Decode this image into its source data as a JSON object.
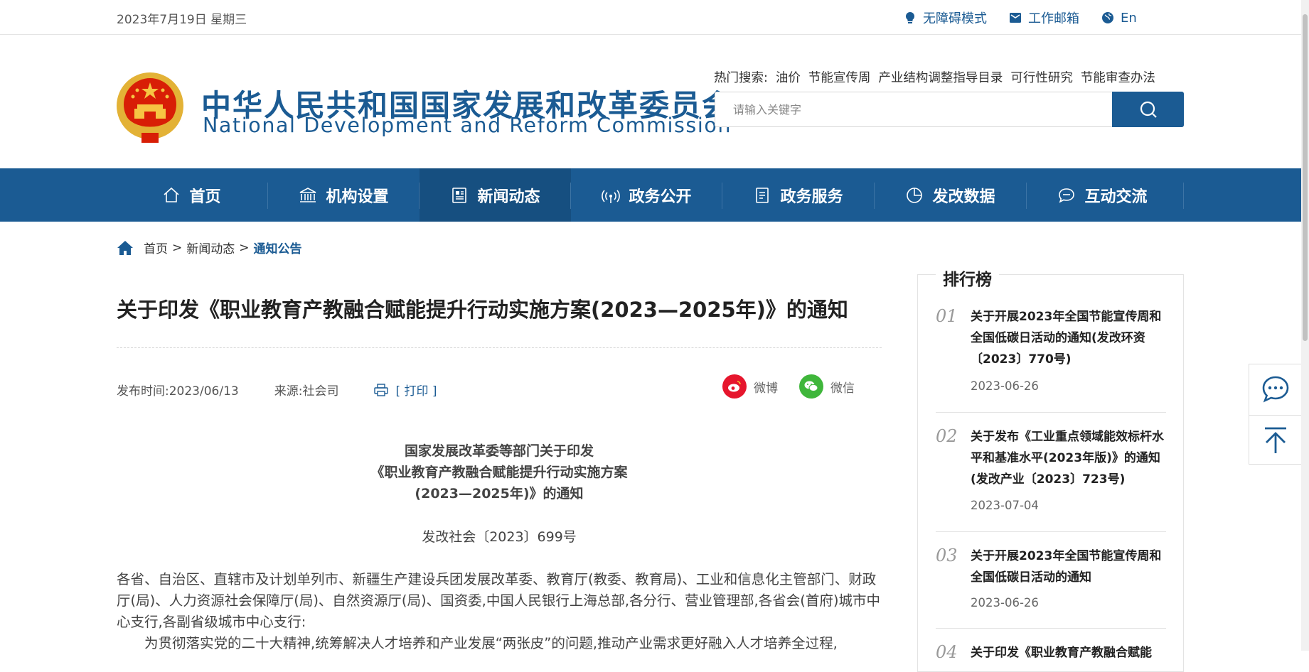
{
  "topbar": {
    "date": "2023年7月19日 星期三",
    "links": [
      {
        "icon": "bulb-icon",
        "label": "无障碍模式"
      },
      {
        "icon": "mail-icon",
        "label": "工作邮箱"
      },
      {
        "icon": "globe-icon",
        "label": "En"
      }
    ]
  },
  "header": {
    "title_cn": "中华人民共和国国家发展和改革委员会",
    "title_en": "National Development and Reform Commission",
    "hot_label": "热门搜索:",
    "hot_keywords": [
      "油价",
      "节能宣传周",
      "产业结构调整指导目录",
      "可行性研究",
      "节能审查办法"
    ],
    "search_placeholder": "请输入关键字"
  },
  "nav": {
    "items": [
      {
        "label": "首页",
        "icon": "home-icon"
      },
      {
        "label": "机构设置",
        "icon": "institution-icon"
      },
      {
        "label": "新闻动态",
        "icon": "news-icon",
        "active": true
      },
      {
        "label": "政务公开",
        "icon": "broadcast-icon"
      },
      {
        "label": "政务服务",
        "icon": "document-icon"
      },
      {
        "label": "发改数据",
        "icon": "pie-chart-icon"
      },
      {
        "label": "互动交流",
        "icon": "chat-icon"
      }
    ]
  },
  "breadcrumb": {
    "items": [
      "首页",
      "新闻动态",
      "通知公告"
    ],
    "separator": ">"
  },
  "article": {
    "title": "关于印发《职业教育产教融合赋能提升行动实施方案(2023—2025年)》的通知",
    "publish_label": "发布时间:2023/06/13",
    "source_label": "来源:社会司",
    "print_label": "[ 打印 ]",
    "share": [
      {
        "label": "微博",
        "icon": "weibo-icon",
        "color": "#e6162d"
      },
      {
        "label": "微信",
        "icon": "wechat-icon",
        "color": "#3fb63b"
      }
    ],
    "doc_heading": [
      "国家发展改革委等部门关于印发",
      "《职业教育产教融合赋能提升行动实施方案",
      "(2023—2025年)》的通知"
    ],
    "doc_number": "发改社会〔2023〕699号",
    "paragraphs": [
      "各省、自治区、直辖市及计划单列市、新疆生产建设兵团发展改革委、教育厅(教委、教育局)、工业和信息化主管部门、财政厅(局)、人力资源社会保障厅(局)、自然资源厅(局)、国资委,中国人民银行上海总部,各分行、营业管理部,各省会(首府)城市中心支行,各副省级城市中心支行:",
      "为贯彻落实党的二十大精神,统筹解决人才培养和产业发展“两张皮”的问题,推动产业需求更好融入人才培养全过程,"
    ]
  },
  "ranking": {
    "title": "排行榜",
    "items": [
      {
        "num": "01",
        "title": "关于开展2023年全国节能宣传周和全国低碳日活动的通知(发改环资〔2023〕770号)",
        "date": "2023-06-26"
      },
      {
        "num": "02",
        "title": "关于发布《工业重点领域能效标杆水平和基准水平(2023年版)》的通知(发改产业〔2023〕723号)",
        "date": "2023-07-04"
      },
      {
        "num": "03",
        "title": "关于开展2023年全国节能宣传周和全国低碳日活动的通知",
        "date": "2023-06-26"
      },
      {
        "num": "04",
        "title": "关于印发《职业教育产教融合赋能",
        "date": ""
      }
    ]
  },
  "sidetools": [
    {
      "icon": "message-icon"
    },
    {
      "icon": "back-to-top-icon"
    }
  ],
  "colors": {
    "brand": "#1b5b93",
    "nav_active": "#164f80"
  }
}
